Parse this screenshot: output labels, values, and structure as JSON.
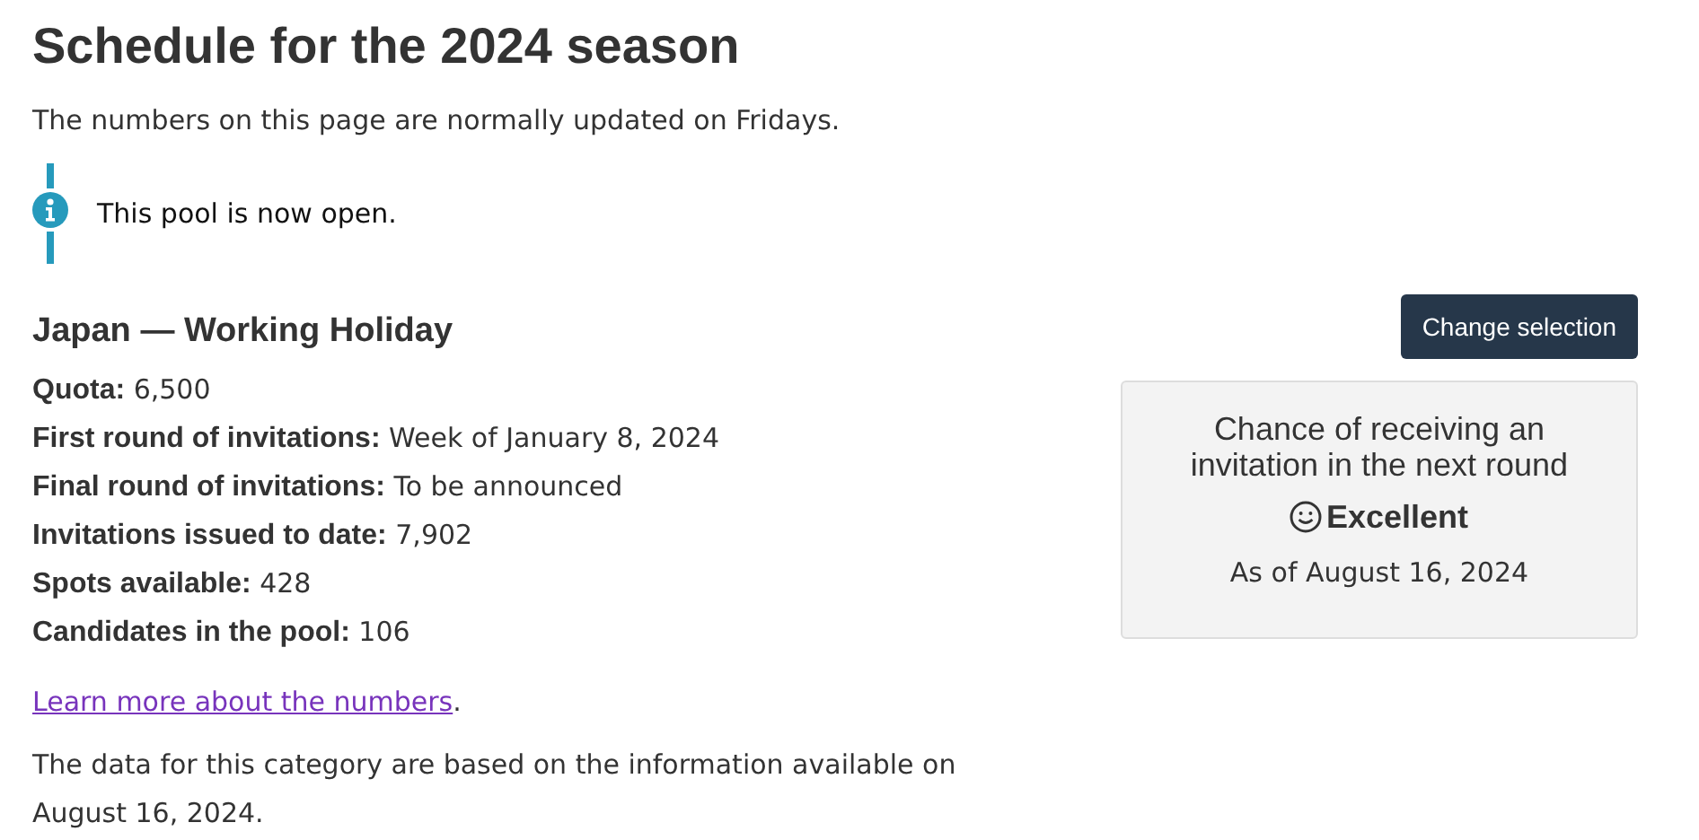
{
  "title": "Schedule for the 2024 season",
  "intro": "The numbers on this page are normally updated on Fridays.",
  "notice": {
    "text": "This pool is now open."
  },
  "category": {
    "heading": "Japan — Working Holiday",
    "facts": [
      {
        "label": "Quota:",
        "value": "6,500"
      },
      {
        "label": "First round of invitations:",
        "value": "Week of January 8, 2024"
      },
      {
        "label": "Final round of invitations:",
        "value": "To be announced"
      },
      {
        "label": "Invitations issued to date:",
        "value": "7,902"
      },
      {
        "label": "Spots available:",
        "value": "428"
      },
      {
        "label": "Candidates in the pool:",
        "value": "106"
      }
    ],
    "learn_more": {
      "link": "Learn more about the numbers",
      "after": "."
    },
    "footnote": "The data for this category are based on the information available on August 16, 2024."
  },
  "change_button": "Change selection",
  "chance_card": {
    "heading": "Chance of receiving an invitation in the next round",
    "rating": "Excellent",
    "as_of": "As of August 16, 2024"
  }
}
